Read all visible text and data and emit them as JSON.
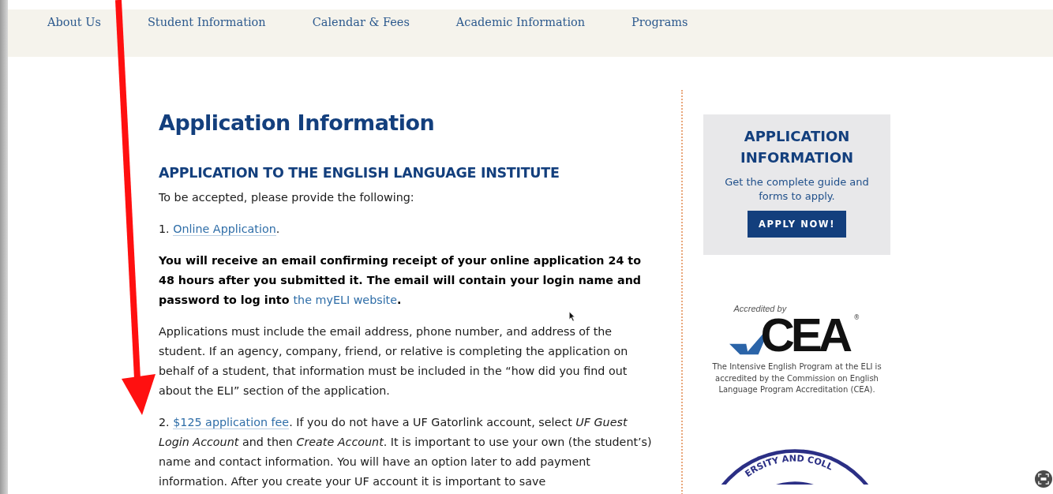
{
  "nav": {
    "items": [
      {
        "label": "About Us"
      },
      {
        "label": "Student Information"
      },
      {
        "label": "Calendar & Fees"
      },
      {
        "label": "Academic Information"
      },
      {
        "label": "Programs"
      }
    ]
  },
  "main": {
    "title": "Application Information",
    "subtitle": "APPLICATION TO THE ENGLISH LANGUAGE INSTITUTE",
    "paragraphs": [
      {
        "kind": "plain",
        "text": "To be accepted, please provide the following:"
      },
      {
        "kind": "link",
        "before": "1. ",
        "link": "Online Application",
        "after": "."
      },
      {
        "kind": "bold-link",
        "before": "You will receive an email confirming receipt of your online application 24 to 48 hours after you submitted it. The email will contain your login name and password to log into ",
        "link": "the myELI website",
        "after": "."
      },
      {
        "kind": "plain",
        "text": "Applications must include the email address, phone number, and address of the student. If an agency, company, friend, or relative is completing the application on behalf of a student, that information must be included in the “how did you find out about the ELI” section of the application."
      },
      {
        "kind": "link",
        "before": "2. ",
        "link": "$125 application fee",
        "after": ". If you do not have a UF Gatorlink account, select *UF Guest Login Account* and then *Create Account*. It is important to use your own (the student’s) name and contact information. You will have an option later to add payment information. After you create your UF account it is important to save"
      }
    ]
  },
  "sidebar": {
    "promo": {
      "title": "APPLICATION INFORMATION",
      "text": "Get the complete guide and forms to apply.",
      "button": "APPLY NOW!"
    },
    "accreditation": {
      "tagline": "Accredited by",
      "logo_text": "CEA",
      "mark": "®",
      "caption": "The Intensive English Program at the ELI is accredited by the Commission on English Language Program Accreditation (CEA)."
    },
    "seal_text": "ERSITY AND COLL"
  }
}
